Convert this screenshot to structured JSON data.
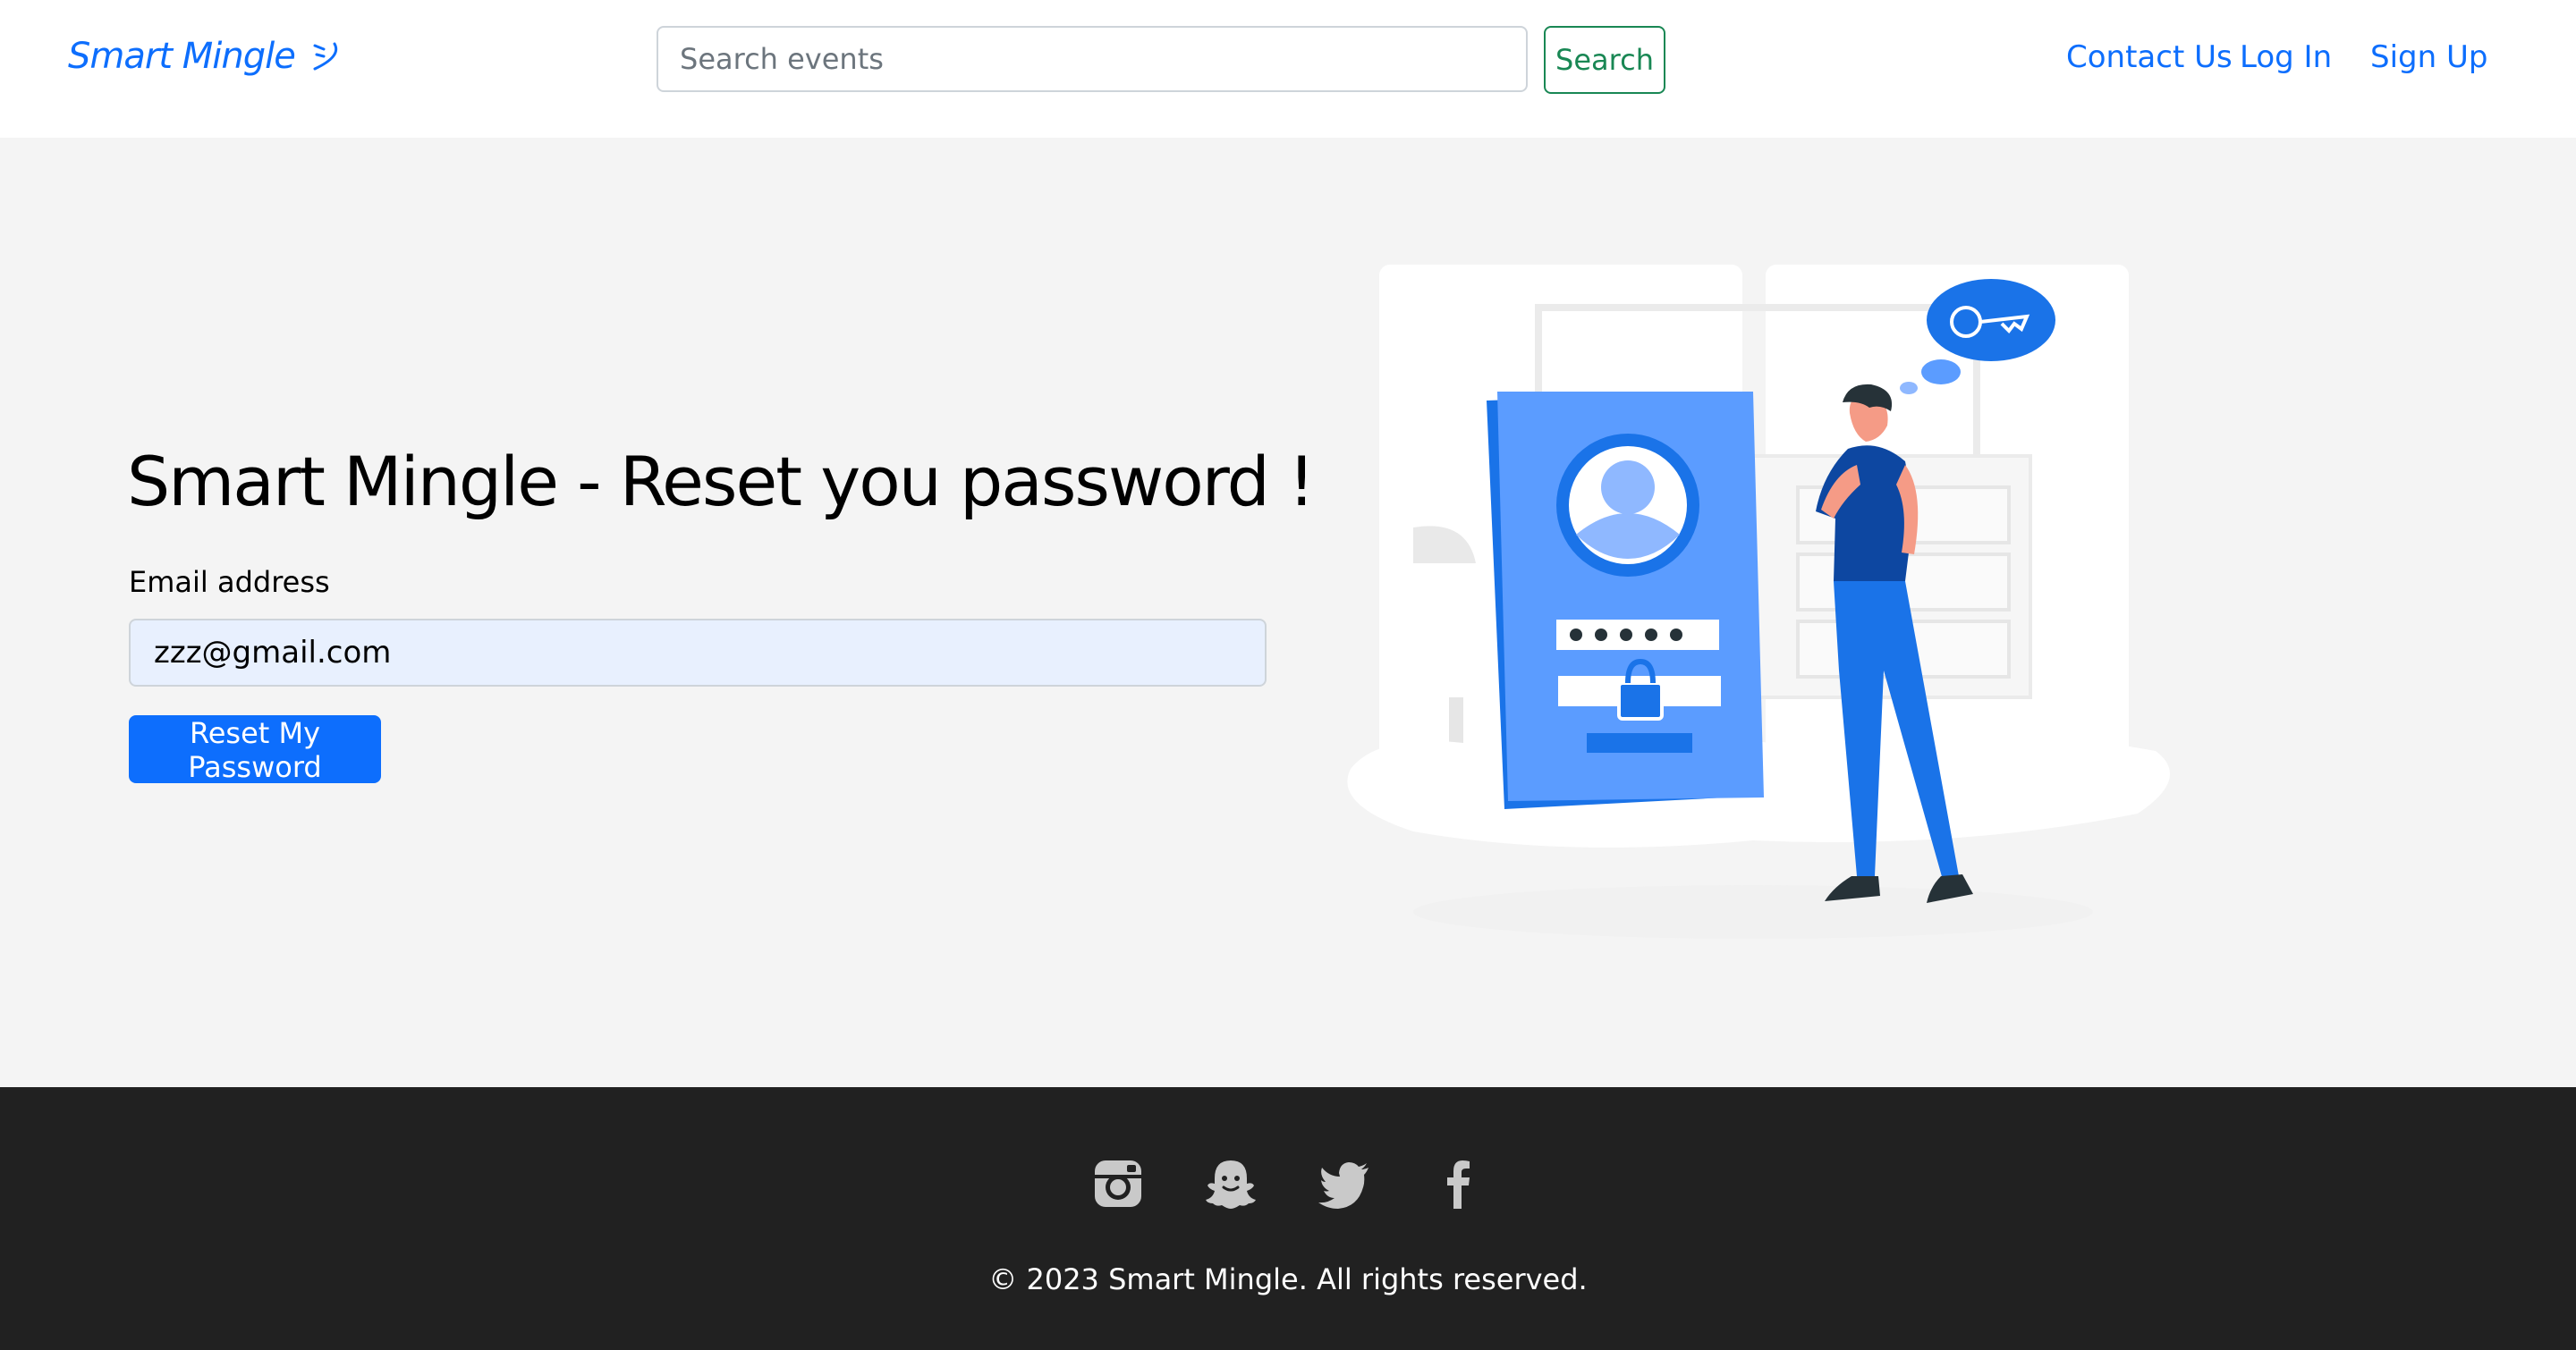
{
  "navbar": {
    "brand": "Smart Mingle",
    "brand_icon": "smiley-icon",
    "search_placeholder": "Search events",
    "search_button": "Search",
    "links": [
      "Contact Us",
      "Log In",
      "Sign Up"
    ]
  },
  "main": {
    "title": "Smart Mingle - Reset you password !",
    "email_label": "Email address",
    "email_value": "zzz@gmail.com",
    "reset_button": "Reset My Password",
    "illustration": "password-reset-illustration"
  },
  "footer": {
    "social_icons": [
      "instagram-icon",
      "snapchat-icon",
      "twitter-icon",
      "facebook-icon"
    ],
    "copyright": "© 2023 Smart Mingle. All rights reserved."
  },
  "colors": {
    "primary": "#0d6efd",
    "success": "#198754",
    "footer_bg": "#212121",
    "page_bg": "#f4f4f4"
  }
}
